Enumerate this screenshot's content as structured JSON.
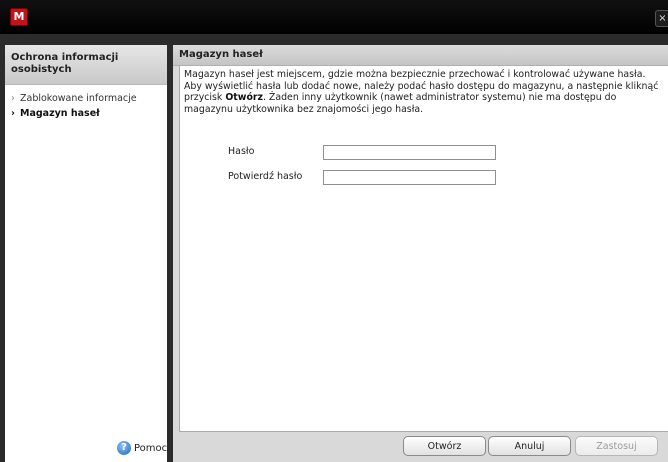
{
  "window": {
    "logo_letter": "M",
    "close_glyph": "×"
  },
  "sidebar": {
    "title": "Ochrona informacji osobistych",
    "items": [
      {
        "label": "Zablokowane informacje",
        "active": false
      },
      {
        "label": "Magazyn haseł",
        "active": true
      }
    ],
    "help_label": "Pomoc",
    "help_icon": "?"
  },
  "main": {
    "title": "Magazyn haseł",
    "description_part1": "Magazyn haseł jest miejscem, gdzie można bezpiecznie przechować i kontrolować używane hasła. Aby wyświetlić hasła lub dodać nowe, należy podać hasło dostępu do magazynu, a następnie kliknąć przycisk ",
    "description_bold": "Otwórz",
    "description_part2": ". Żaden inny użytkownik (nawet administrator systemu) nie ma dostępu do magazynu użytkownika bez znajomości jego hasła.",
    "password_label": "Hasło",
    "password_value": "",
    "confirm_label": "Potwierdź hasło",
    "confirm_value": ""
  },
  "buttons": {
    "open": "Otwórz",
    "cancel": "Anuluj",
    "apply": "Zastosuj"
  },
  "colors": {
    "logo": "#c0141c",
    "frame": "#2b2b2b",
    "panel_header": "#c9c9c9"
  }
}
